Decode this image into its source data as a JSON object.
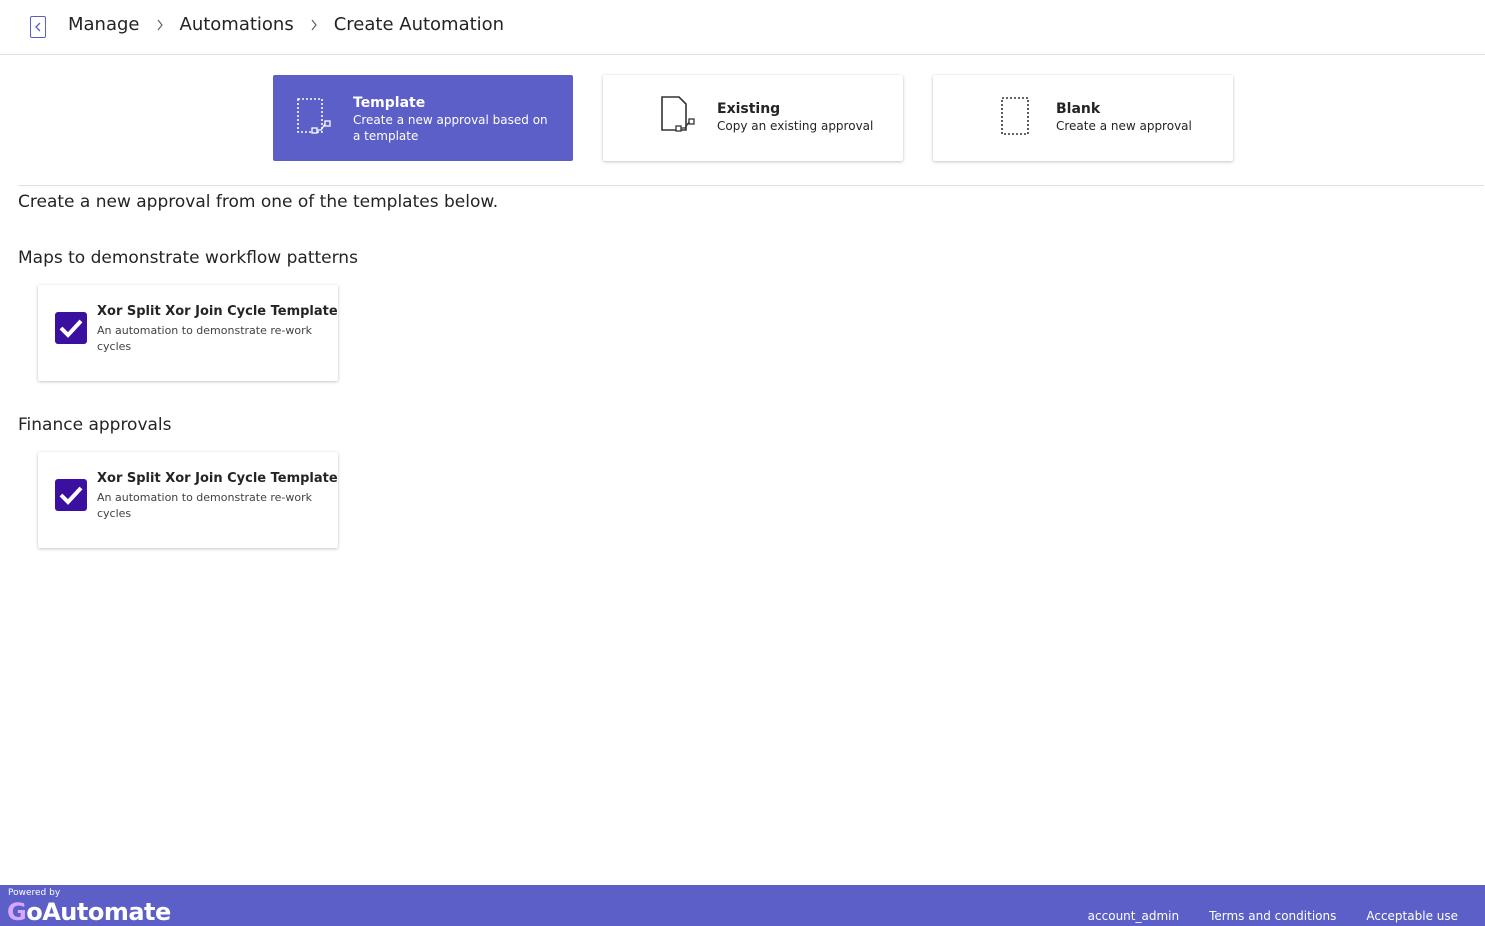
{
  "breadcrumb": {
    "items": [
      "Manage",
      "Automations",
      "Create Automation"
    ]
  },
  "options": [
    {
      "title": "Template",
      "description": "Create a new approval based on a template",
      "selected": true
    },
    {
      "title": "Existing",
      "description": "Copy an existing approval",
      "selected": false
    },
    {
      "title": "Blank",
      "description": "Create a new approval",
      "selected": false
    }
  ],
  "intro": "Create a new approval from one of the templates below.",
  "groups": [
    {
      "title": "Maps to demonstrate workflow patterns",
      "templates": [
        {
          "title": "Xor Split Xor Join Cycle Template",
          "description": "An automation to demonstrate re-work cycles",
          "icon": "checkbox-icon"
        }
      ]
    },
    {
      "title": "Finance approvals",
      "templates": [
        {
          "title": "Xor Split Xor Join Cycle Template",
          "description": "An automation to demonstrate re-work cycles",
          "icon": "checkbox-icon"
        }
      ]
    }
  ],
  "footer": {
    "powered_by": "Powered by",
    "logo_g": "G",
    "logo_rest": "oAutomate",
    "links": [
      "account_admin",
      "Terms and conditions",
      "Acceptable use"
    ]
  },
  "colors": {
    "accent": "#5b5fc7",
    "icon_dark": "#3b0fa0",
    "white": "#ffffff"
  }
}
